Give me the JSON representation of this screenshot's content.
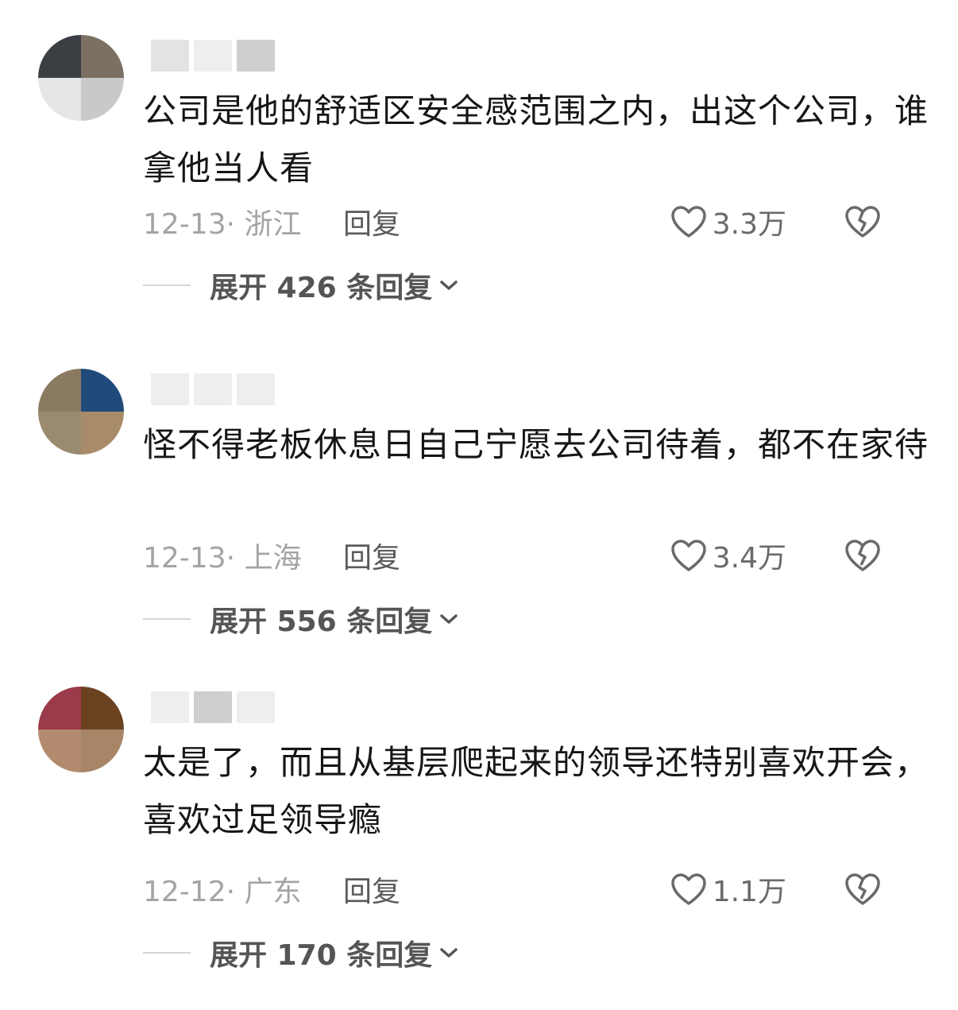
{
  "comments": [
    {
      "avatar_colors": [
        "#3b3f44",
        "#7b7062",
        "#e6e6e6",
        "#c9c9c9"
      ],
      "text": "公司是他的舒适区安全感范围之内，出这个公司，谁拿他当人看",
      "date": "12-13·",
      "location": "浙江",
      "reply_label": "回复",
      "likes": "3.3万",
      "expand_label": "展开 426 条回复"
    },
    {
      "avatar_colors": [
        "#8b7a62",
        "#1f4a7a",
        "#9a8a70",
        "#a88c6a"
      ],
      "text": "怪不得老板休息日自己宁愿去公司待着，都不在家待",
      "date": "12-13·",
      "location": "上海",
      "reply_label": "回复",
      "likes": "3.4万",
      "expand_label": "展开 556 条回复"
    },
    {
      "avatar_colors": [
        "#9a3a4a",
        "#6b4220",
        "#b28b6e",
        "#a88567"
      ],
      "text": "太是了，而且从基层爬起来的领导还特别喜欢开会，喜欢过足领导瘾",
      "date": "12-12·",
      "location": "广东",
      "reply_label": "回复",
      "likes": "1.1万",
      "expand_label": "展开 170 条回复"
    }
  ]
}
